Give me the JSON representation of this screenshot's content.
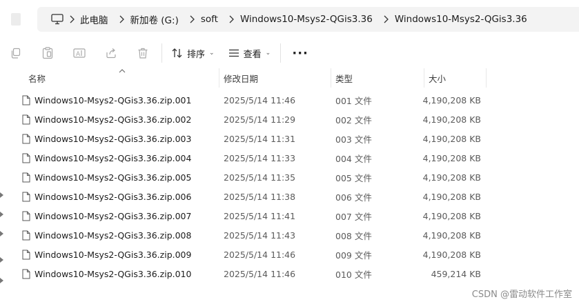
{
  "breadcrumb": {
    "items": [
      "此电脑",
      "新加卷 (G:)",
      "soft",
      "Windows10-Msys2-QGis3.36",
      "Windows10-Msys2-QGis3.36"
    ]
  },
  "toolbar": {
    "copy_icon": "copy-icon",
    "paste_icon": "paste-icon",
    "rename_icon": "rename-icon",
    "share_icon": "share-icon",
    "delete_icon": "delete-icon",
    "sort_label": "排序",
    "view_label": "查看",
    "more_label": "···"
  },
  "columns": {
    "name": "名称",
    "date": "修改日期",
    "type": "类型",
    "size": "大小"
  },
  "files": [
    {
      "name": "Windows10-Msys2-QGis3.36.zip.001",
      "date": "2025/5/14 11:46",
      "type": "001 文件",
      "size": "4,190,208 KB"
    },
    {
      "name": "Windows10-Msys2-QGis3.36.zip.002",
      "date": "2025/5/14 11:29",
      "type": "002 文件",
      "size": "4,190,208 KB"
    },
    {
      "name": "Windows10-Msys2-QGis3.36.zip.003",
      "date": "2025/5/14 11:31",
      "type": "003 文件",
      "size": "4,190,208 KB"
    },
    {
      "name": "Windows10-Msys2-QGis3.36.zip.004",
      "date": "2025/5/14 11:33",
      "type": "004 文件",
      "size": "4,190,208 KB"
    },
    {
      "name": "Windows10-Msys2-QGis3.36.zip.005",
      "date": "2025/5/14 11:35",
      "type": "005 文件",
      "size": "4,190,208 KB"
    },
    {
      "name": "Windows10-Msys2-QGis3.36.zip.006",
      "date": "2025/5/14 11:38",
      "type": "006 文件",
      "size": "4,190,208 KB"
    },
    {
      "name": "Windows10-Msys2-QGis3.36.zip.007",
      "date": "2025/5/14 11:41",
      "type": "007 文件",
      "size": "4,190,208 KB"
    },
    {
      "name": "Windows10-Msys2-QGis3.36.zip.008",
      "date": "2025/5/14 11:43",
      "type": "008 文件",
      "size": "4,190,208 KB"
    },
    {
      "name": "Windows10-Msys2-QGis3.36.zip.009",
      "date": "2025/5/14 11:46",
      "type": "009 文件",
      "size": "4,190,208 KB"
    },
    {
      "name": "Windows10-Msys2-QGis3.36.zip.010",
      "date": "2025/5/14 11:46",
      "type": "010 文件",
      "size": "459,214 KB"
    }
  ],
  "watermark": "CSDN @雷动软件工作室",
  "colors": {
    "address_bg": "#f3f3f3",
    "text": "#1b1b1b",
    "muted": "#5a5a5a",
    "disabled_icon": "#a8a8a8"
  }
}
